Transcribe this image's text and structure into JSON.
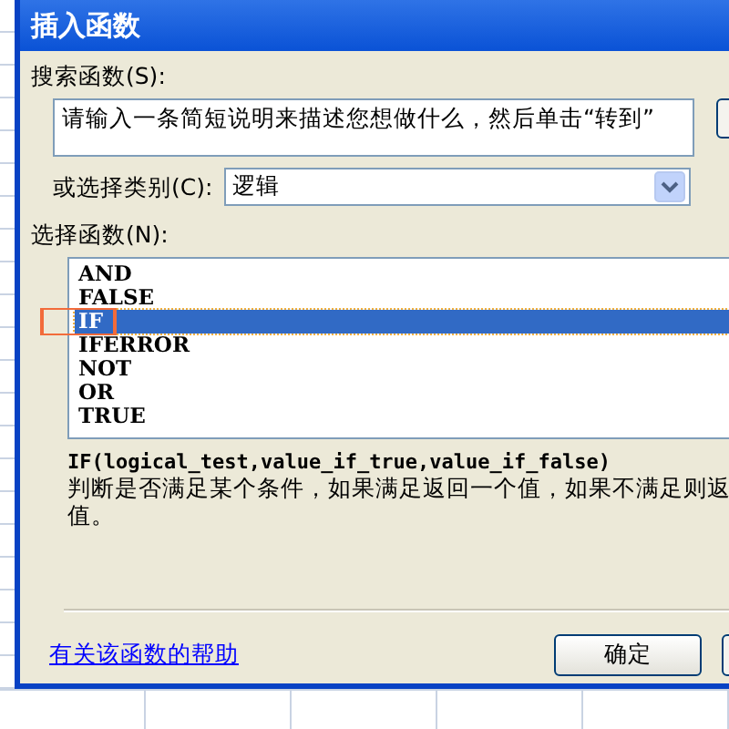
{
  "window": {
    "title": "插入函数"
  },
  "search": {
    "label": "搜索函数(S):",
    "value": "请输入一条简短说明来描述您想做什么，然后单击“转到”"
  },
  "category": {
    "label": "或选择类别(C):",
    "value": "逻辑"
  },
  "functions": {
    "label": "选择函数(N):",
    "items": [
      {
        "label": "AND",
        "selected": false
      },
      {
        "label": "FALSE",
        "selected": false
      },
      {
        "label": "IF",
        "selected": true
      },
      {
        "label": "IFERROR",
        "selected": false
      },
      {
        "label": "NOT",
        "selected": false
      },
      {
        "label": "OR",
        "selected": false
      },
      {
        "label": "TRUE",
        "selected": false
      }
    ]
  },
  "signature": "IF(logical_test,value_if_true,value_if_false)",
  "description": [
    "判断是否满足某个条件，如果满足返回一个值，如果不满足则返",
    "值。"
  ],
  "help_link": "有关该函数的帮助",
  "buttons": [
    "确定"
  ]
}
